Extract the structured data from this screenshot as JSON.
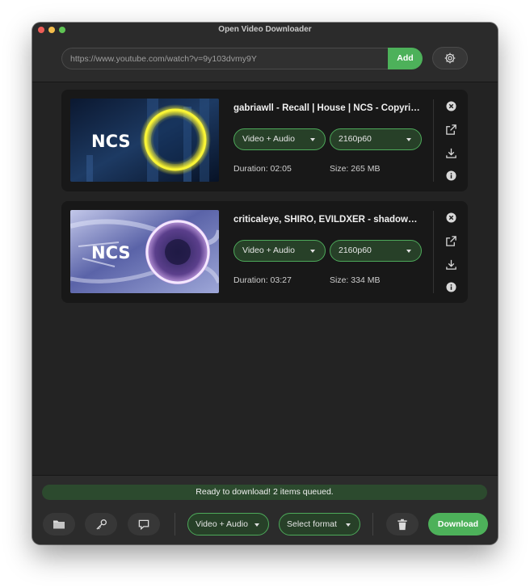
{
  "window": {
    "title": "Open Video Downloader"
  },
  "url_bar": {
    "value": "https://www.youtube.com/watch?v=9y103dvmy9Y",
    "add_label": "Add"
  },
  "items": [
    {
      "thumbnail_text": "NCS",
      "title": "gabriawll - Recall | House | NCS - Copyright Free Music",
      "format": "Video + Audio",
      "quality": "2160p60",
      "duration": "Duration: 02:05",
      "size": "Size: 265 MB"
    },
    {
      "thumbnail_text": "NCS",
      "title": "criticaleye, SHIRO, EVILDXER - shadows | NCS - Copyright Free Music",
      "format": "Video + Audio",
      "quality": "2160p60",
      "duration": "Duration: 03:27",
      "size": "Size: 334 MB"
    }
  ],
  "item_actions": [
    "close-icon",
    "open-external-icon",
    "download-icon",
    "info-icon"
  ],
  "footer": {
    "status": "Ready to download! 2 items queued.",
    "buttons": [
      "folder-icon",
      "key-icon",
      "speech-bubble-icon"
    ],
    "format_select": "Video + Audio",
    "quality_select": "Select format",
    "clear_icon": "trash-icon",
    "download_label": "Download"
  },
  "colors": {
    "accent": "#4db15a",
    "status_bg": "#2c4a2e",
    "window_bg": "#232323",
    "card_bg": "#181818"
  }
}
